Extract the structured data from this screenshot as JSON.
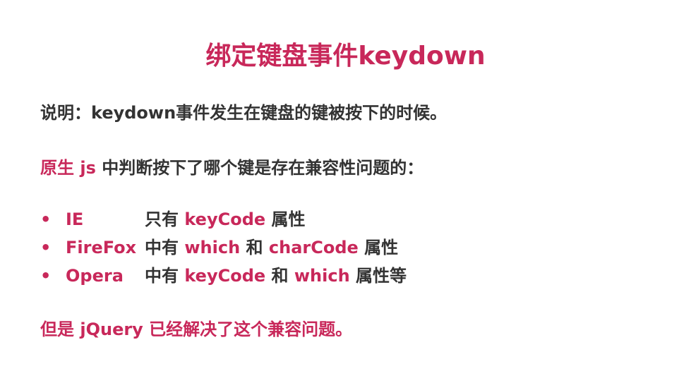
{
  "slide": {
    "title": "绑定键盘事件keydown",
    "description": "说明：keydown事件发生在键盘的键被按下的时候。",
    "native_prefix": "原生 js",
    "native_rest": " 中判断按下了哪个键是存在兼容性问题的：",
    "bullet_char": "•",
    "browsers": [
      {
        "name": "IE",
        "parts": [
          {
            "text": "只有 ",
            "pink": false
          },
          {
            "text": "keyCode",
            "pink": true
          },
          {
            "text": " 属性",
            "pink": false
          }
        ]
      },
      {
        "name": "FireFox",
        "parts": [
          {
            "text": "中有 ",
            "pink": false
          },
          {
            "text": "which",
            "pink": true
          },
          {
            "text": " 和 ",
            "pink": false
          },
          {
            "text": "charCode",
            "pink": true
          },
          {
            "text": " 属性",
            "pink": false
          }
        ]
      },
      {
        "name": "Opera",
        "parts": [
          {
            "text": "中有 ",
            "pink": false
          },
          {
            "text": "keyCode",
            "pink": true
          },
          {
            "text": " 和 ",
            "pink": false
          },
          {
            "text": "which",
            "pink": true
          },
          {
            "text": " 属性等",
            "pink": false
          }
        ]
      }
    ],
    "conclusion": "但是 jQuery 已经解决了这个兼容问题。",
    "colors": {
      "accent": "#c8285a",
      "text": "#333333",
      "background": "#ffffff"
    }
  }
}
